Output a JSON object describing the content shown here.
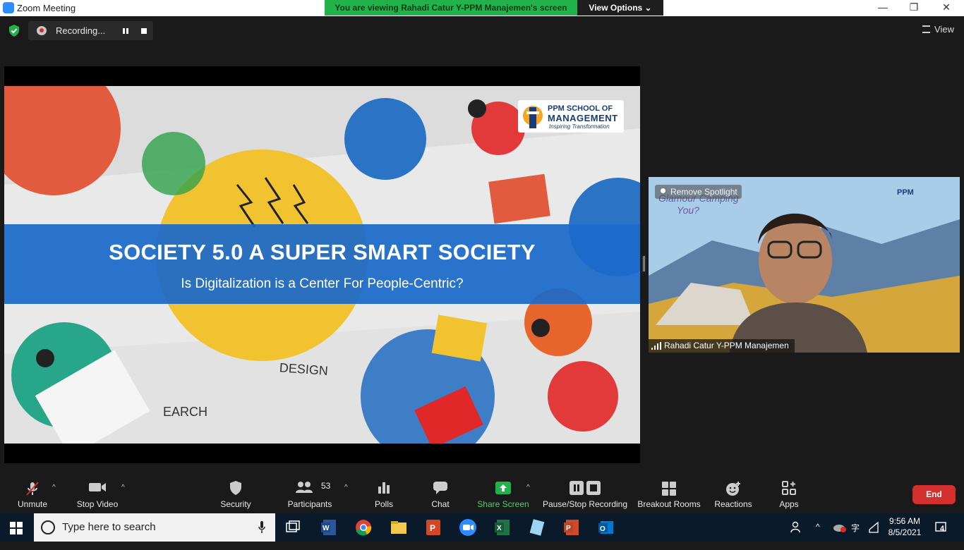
{
  "window": {
    "title": "Zoom Meeting",
    "minimize_icon": "minimize-icon",
    "maximize_icon": "restore-icon",
    "close_icon": "close-icon"
  },
  "share_banner": {
    "text": "You are viewing Rahadi Catur Y-PPM  Manajemen's screen",
    "view_options": "View Options ⌄",
    "color": "#22b24c"
  },
  "recording": {
    "label": "Recording...",
    "pause_icon": "pause-icon",
    "stop_icon": "stop-icon"
  },
  "view_button": "View",
  "slide": {
    "title": "SOCIETY 5.0 A SUPER SMART SOCIETY",
    "subtitle": "Is Digitalization is a Center For People-Centric?",
    "logo_line1": "PPM SCHOOL OF",
    "logo_line2": "MANAGEMENT",
    "logo_line3": "Inspiring Transformation",
    "accent": "#1b69c9"
  },
  "video": {
    "spotlight_label": "Remove Spotlight",
    "participant_name": "Rahadi Catur Y-PPM Manajemen"
  },
  "toolbar": {
    "unmute": "Unmute",
    "stop_video": "Stop Video",
    "security": "Security",
    "participants": "Participants",
    "participants_count": "53",
    "polls": "Polls",
    "chat": "Chat",
    "share_screen": "Share Screen",
    "pause_recording": "Pause/Stop Recording",
    "breakout": "Breakout Rooms",
    "reactions": "Reactions",
    "apps": "Apps",
    "end": "End",
    "end_color": "#d32f2f",
    "share_color": "#22b24c"
  },
  "taskbar": {
    "search_placeholder": "Type here to search",
    "time": "9:56 AM",
    "date": "8/5/2021",
    "notifications": "4",
    "apps": [
      "task-view-icon",
      "word-icon",
      "chrome-icon",
      "file-explorer-icon",
      "powerpoint-icon",
      "zoom-icon",
      "excel-icon",
      "notepad-icon",
      "powerpoint-icon",
      "outlook-icon"
    ]
  }
}
